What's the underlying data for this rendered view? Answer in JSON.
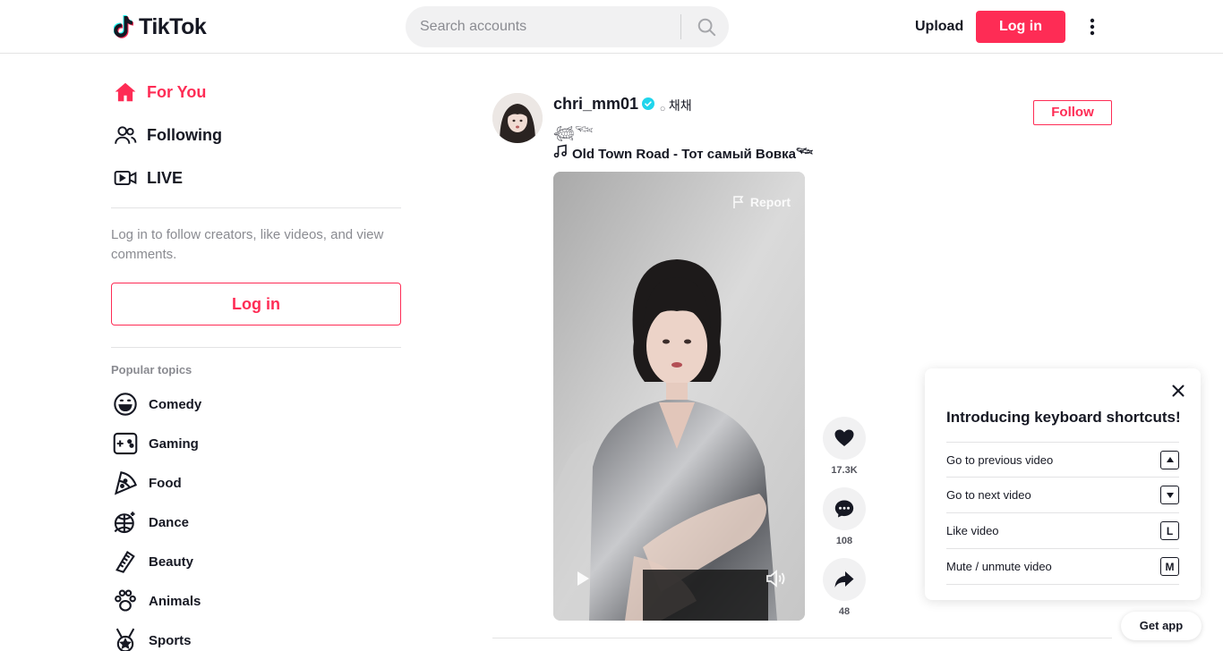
{
  "brand": {
    "name": "TikTok",
    "accent": "#fe2c55",
    "cyan": "#25f4ee"
  },
  "header": {
    "search": {
      "placeholder": "Search accounts",
      "value": ""
    },
    "upload_label": "Upload",
    "login_label": "Log in",
    "more_icon": "more-vertical-icon"
  },
  "sidebar": {
    "nav": [
      {
        "label": "For You",
        "icon": "home-icon",
        "active": true
      },
      {
        "label": "Following",
        "icon": "following-icon",
        "active": false
      },
      {
        "label": "LIVE",
        "icon": "live-icon",
        "active": false
      }
    ],
    "login_hint": "Log in to follow creators, like videos, and view comments.",
    "login_button": "Log in",
    "topics_title": "Popular topics",
    "topics": [
      {
        "label": "Comedy",
        "icon": "comedy-icon"
      },
      {
        "label": "Gaming",
        "icon": "gaming-icon"
      },
      {
        "label": "Food",
        "icon": "food-icon"
      },
      {
        "label": "Dance",
        "icon": "dance-icon"
      },
      {
        "label": "Beauty",
        "icon": "beauty-icon"
      },
      {
        "label": "Animals",
        "icon": "animals-icon"
      },
      {
        "label": "Sports",
        "icon": "sports-icon"
      }
    ]
  },
  "post": {
    "author": "chri_mm01",
    "verified": true,
    "nickname": "𓂂 채채",
    "caption": "𓆉𓆝",
    "music": "Old Town Road - Тот самый Вовка𓆝",
    "follow_label": "Follow",
    "report_label": "Report",
    "actions": [
      {
        "icon": "heart-icon",
        "count": "17.3K"
      },
      {
        "icon": "comment-icon",
        "count": "108"
      },
      {
        "icon": "share-icon",
        "count": "48"
      }
    ]
  },
  "shortcuts": {
    "title": "Introducing keyboard shortcuts!",
    "items": [
      {
        "label": "Go to previous video",
        "key": "up-arrow-key-icon"
      },
      {
        "label": "Go to next video",
        "key": "down-arrow-key-icon"
      },
      {
        "label": "Like video",
        "key": "L"
      },
      {
        "label": "Mute / unmute video",
        "key": "M"
      }
    ]
  },
  "get_app_label": "Get app"
}
